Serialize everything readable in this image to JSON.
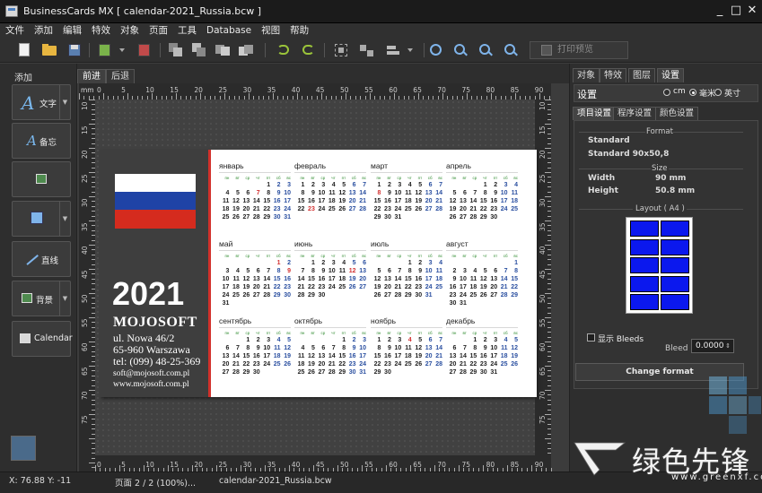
{
  "window": {
    "title": "BusinessCards MX [ calendar-2021_Russia.bcw ]",
    "minimize": "_",
    "maximize": "□",
    "close": "✕"
  },
  "menu": [
    "文件",
    "添加",
    "编辑",
    "特效",
    "对象",
    "页面",
    "工具",
    "Database",
    "视图",
    "帮助"
  ],
  "toolbar": {
    "print_label": "打印预览"
  },
  "left_panel": {
    "title": "添加",
    "buttons": [
      {
        "label": "文字",
        "icon": "text-icon",
        "has_arrow": true
      },
      {
        "label": "备忘",
        "icon": "memo-icon",
        "has_arrow": false
      },
      {
        "label": "",
        "icon": "image-icon",
        "has_arrow": false
      },
      {
        "label": "",
        "icon": "shape-icon",
        "has_arrow": true
      },
      {
        "label": "直线",
        "icon": "line-icon",
        "has_arrow": false
      },
      {
        "label": "背景",
        "icon": "background-icon",
        "has_arrow": true
      },
      {
        "label": "Calendar",
        "icon": "calendar-icon",
        "has_arrow": false
      }
    ]
  },
  "doc_tabs": [
    {
      "label": "前进",
      "active": true
    },
    {
      "label": "后退",
      "active": false
    }
  ],
  "ruler": {
    "unit": "mm",
    "top_ticks": [
      "0",
      "5",
      "10",
      "15",
      "20",
      "25",
      "30",
      "35",
      "40",
      "45",
      "50",
      "55",
      "60",
      "65",
      "70",
      "75",
      "80",
      "85",
      "90"
    ],
    "left_ticks": [
      "10",
      "15",
      "20",
      "25",
      "30",
      "35",
      "40",
      "45",
      "50",
      "55",
      "60",
      "65",
      "70",
      "75"
    ]
  },
  "card": {
    "year": "2021",
    "company": "MOJOSOFT",
    "address": [
      "ul. Nowa 46/2",
      "65-960 Warszawa",
      "tel: (099) 48-25-369"
    ],
    "web": [
      "soft@mojosoft.com.pl",
      "www.mojosoft.com.pl"
    ],
    "flag_colors": [
      "#ffffff",
      "#1f43a6",
      "#d52b1e"
    ],
    "dow": [
      "пн",
      "вт",
      "ср",
      "чт",
      "пт",
      "сб",
      "вс"
    ],
    "months": [
      {
        "name": "январь",
        "offset": 4,
        "days": 31,
        "hol": [
          7
        ]
      },
      {
        "name": "февраль",
        "offset": 0,
        "days": 28,
        "hol": [
          23
        ]
      },
      {
        "name": "март",
        "offset": 0,
        "days": 31,
        "hol": [
          8
        ]
      },
      {
        "name": "апрель",
        "offset": 3,
        "days": 30,
        "hol": []
      },
      {
        "name": "май",
        "offset": 5,
        "days": 31,
        "hol": [
          1,
          9
        ]
      },
      {
        "name": "июнь",
        "offset": 1,
        "days": 30,
        "hol": [
          12
        ]
      },
      {
        "name": "июль",
        "offset": 3,
        "days": 31,
        "hol": []
      },
      {
        "name": "август",
        "offset": 6,
        "days": 31,
        "hol": []
      },
      {
        "name": "сентябрь",
        "offset": 2,
        "days": 30,
        "hol": []
      },
      {
        "name": "октябрь",
        "offset": 4,
        "days": 31,
        "hol": []
      },
      {
        "name": "ноябрь",
        "offset": 0,
        "days": 30,
        "hol": [
          4
        ]
      },
      {
        "name": "декабрь",
        "offset": 2,
        "days": 31,
        "hol": []
      }
    ]
  },
  "right_panel": {
    "tabs": [
      {
        "label": "对象",
        "active": false
      },
      {
        "label": "特效",
        "active": false
      },
      {
        "label": "图层",
        "active": false
      },
      {
        "label": "设置",
        "active": true
      }
    ],
    "settings_title": "设置",
    "units": [
      {
        "label": "cm",
        "on": false
      },
      {
        "label": "毫米",
        "on": true
      },
      {
        "label": "英寸",
        "on": false
      }
    ],
    "sub_tabs": [
      {
        "label": "项目设置",
        "active": true
      },
      {
        "label": "程序设置",
        "active": false
      },
      {
        "label": "颜色设置",
        "active": false
      }
    ],
    "format_title": "Format",
    "format_value": "Standard",
    "format_detail": "Standard 90x50,8",
    "size_title": "Size",
    "width_label": "Width",
    "width_value": "90 mm",
    "height_label": "Height",
    "height_value": "50.8 mm",
    "layout_title": "Layout ( A4 )",
    "bleeds_label": "显示 Bleeds",
    "bleed_caption": "Bleed :",
    "bleed_value": "0.0000",
    "change_format": "Change format",
    "accent": "#0b18ee"
  },
  "status": {
    "coords": "X: 76.88 Y: -11",
    "page": "页面 2 / 2 (100%)...",
    "file": "calendar-2021_Russia.bcw"
  },
  "watermark": {
    "text": "绿色先锋",
    "url": "www.greenxf.com"
  }
}
